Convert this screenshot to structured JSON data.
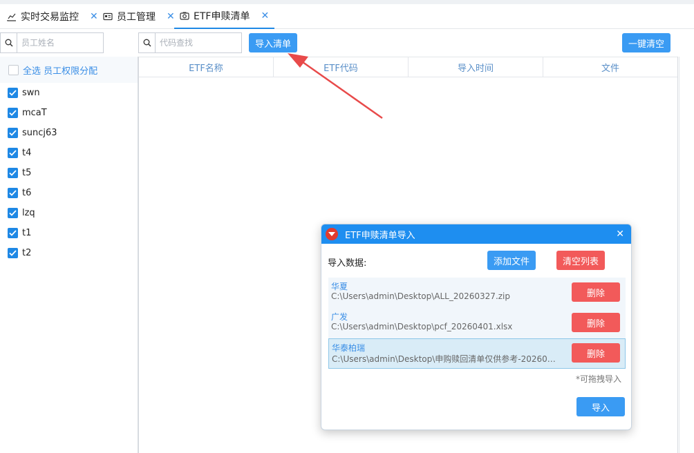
{
  "tabs": [
    {
      "label": "实时交易监控",
      "icon": "line-chart-icon",
      "active": false
    },
    {
      "label": "员工管理",
      "icon": "id-card-icon",
      "active": false
    },
    {
      "label": "ETF申赎清单",
      "icon": "camera-icon",
      "active": true
    }
  ],
  "toolbar": {
    "employee_search_placeholder": "员工姓名",
    "code_search_placeholder": "代码查找",
    "import_list_label": "导入清单",
    "clear_all_label": "一键清空"
  },
  "left_panel": {
    "select_all_label": "全选  员工权限分配",
    "employees": [
      {
        "name": "swn",
        "checked": true
      },
      {
        "name": "mcaT",
        "checked": true
      },
      {
        "name": "suncj63",
        "checked": true
      },
      {
        "name": "t4",
        "checked": true
      },
      {
        "name": "t5",
        "checked": true
      },
      {
        "name": "t6",
        "checked": true
      },
      {
        "name": "lzq",
        "checked": true
      },
      {
        "name": "t1",
        "checked": true
      },
      {
        "name": "t2",
        "checked": true
      }
    ]
  },
  "grid": {
    "columns": [
      "ETF名称",
      "ETF代码",
      "导入时间",
      "文件"
    ]
  },
  "dialog": {
    "title": "ETF申赎清单导入",
    "data_label": "导入数据:",
    "add_file_label": "添加文件",
    "clear_list_label": "清空列表",
    "files": [
      {
        "name": "华夏",
        "path": "C:\\Users\\admin\\Desktop\\ALL_20260327.zip",
        "delete_label": "删除",
        "selected": false
      },
      {
        "name": "广发",
        "path": "C:\\Users\\admin\\Desktop\\pcf_20260401.xlsx",
        "delete_label": "删除",
        "selected": false
      },
      {
        "name": "华泰柏瑞",
        "path": "C:\\Users\\admin\\Desktop\\申购赎回清单仅供参考-202603...",
        "delete_label": "删除",
        "selected": true
      }
    ],
    "hint": "*可拖拽导入",
    "import_label": "导入"
  },
  "colors": {
    "accent": "#1e88e5",
    "button_blue": "#3a9bf3",
    "button_red": "#f25a5a",
    "arrow": "#e84a4a"
  }
}
